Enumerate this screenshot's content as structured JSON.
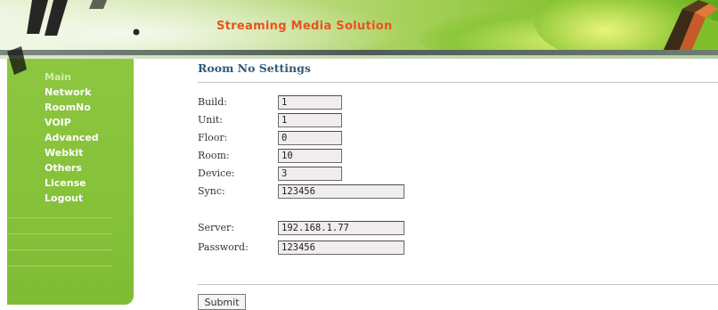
{
  "header": {
    "title": "Streaming Media Solution",
    "title_color": "#e8541c"
  },
  "sidebar": {
    "items": [
      {
        "label": "Main"
      },
      {
        "label": "Network"
      },
      {
        "label": "RoomNo"
      },
      {
        "label": "VOIP"
      },
      {
        "label": "Advanced"
      },
      {
        "label": "Webkit"
      },
      {
        "label": "Others"
      },
      {
        "label": "License"
      },
      {
        "label": "Logout"
      }
    ],
    "color": "#8dc63f"
  },
  "main": {
    "title": "Room No Settings",
    "fields": [
      {
        "label": "Build:",
        "value": "1"
      },
      {
        "label": "Unit:",
        "value": "1"
      },
      {
        "label": "Floor:",
        "value": "0"
      },
      {
        "label": "Room:",
        "value": "10"
      },
      {
        "label": "Device:",
        "value": "3"
      },
      {
        "label": "Sync:",
        "value": "123456"
      },
      {
        "label": "Server:",
        "value": "192.168.1.77"
      },
      {
        "label": "Password:",
        "value": "123456"
      }
    ],
    "submit_label": "Submit"
  }
}
